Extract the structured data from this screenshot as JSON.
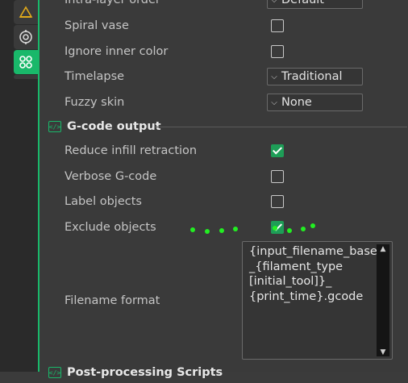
{
  "sidebar": {
    "items": [
      {
        "icon": "bed-icon",
        "active": false
      },
      {
        "icon": "filament-target-icon",
        "active": false
      },
      {
        "icon": "others-icon",
        "active": true
      }
    ]
  },
  "rows_top": [
    {
      "label": "Intra-layer order",
      "type": "combo",
      "value": "Default"
    },
    {
      "label": "Spiral vase",
      "type": "checkbox",
      "checked": false
    },
    {
      "label": "Ignore inner color",
      "type": "checkbox",
      "checked": false
    },
    {
      "label": "Timelapse",
      "type": "combo",
      "value": "Traditional"
    },
    {
      "label": "Fuzzy skin",
      "type": "combo",
      "value": "None"
    }
  ],
  "section_gcode": {
    "title": "G-code output",
    "icon": "code-icon",
    "icon_glyph": "</>"
  },
  "rows_gcode": [
    {
      "label": "Reduce infill retraction",
      "type": "checkbox",
      "checked": true
    },
    {
      "label": "Verbose G-code",
      "type": "checkbox",
      "checked": false
    },
    {
      "label": "Label objects",
      "type": "checkbox",
      "checked": false
    },
    {
      "label": "Exclude objects",
      "type": "checkbox",
      "checked": true
    }
  ],
  "filename_format": {
    "label": "Filename format",
    "value": "{input_filename_base}\n_{filament_type\n[initial_tool]}_\n{print_time}.gcode"
  },
  "section_post": {
    "title": "Post-processing Scripts",
    "icon": "code-icon"
  },
  "colors": {
    "accent": "#19b86a",
    "check": "#1e9d57",
    "dots": "#22ee22"
  }
}
